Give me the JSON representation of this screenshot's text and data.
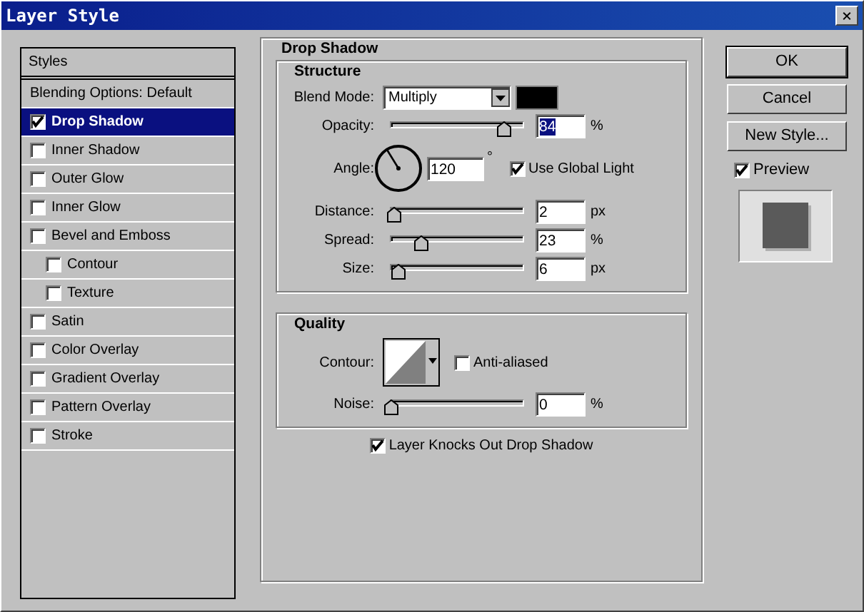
{
  "window": {
    "title": "Layer Style",
    "close": "×"
  },
  "styles_panel": {
    "header": "Styles",
    "blending": "Blending Options: Default",
    "items": [
      {
        "label": "Drop Shadow",
        "checked": true,
        "selected": true
      },
      {
        "label": "Inner Shadow",
        "checked": false,
        "selected": false
      },
      {
        "label": "Outer Glow",
        "checked": false,
        "selected": false
      },
      {
        "label": "Inner Glow",
        "checked": false,
        "selected": false
      },
      {
        "label": "Bevel and Emboss",
        "checked": false,
        "selected": false,
        "children": [
          {
            "label": "Contour",
            "checked": false,
            "selected": false
          },
          {
            "label": "Texture",
            "checked": false,
            "selected": false
          }
        ]
      },
      {
        "label": "Satin",
        "checked": false,
        "selected": false
      },
      {
        "label": "Color Overlay",
        "checked": false,
        "selected": false
      },
      {
        "label": "Gradient Overlay",
        "checked": false,
        "selected": false
      },
      {
        "label": "Pattern Overlay",
        "checked": false,
        "selected": false
      },
      {
        "label": "Stroke",
        "checked": false,
        "selected": false
      }
    ]
  },
  "drop_shadow": {
    "title": "Drop Shadow",
    "structure": {
      "title": "Structure",
      "blend_mode": {
        "label": "Blend Mode:",
        "value": "Multiply"
      },
      "opacity": {
        "label": "Opacity:",
        "level": 0.86,
        "value": "84",
        "unit": "%",
        "value_selected": true
      },
      "angle": {
        "label": "Angle:",
        "value": "120",
        "unit": "°",
        "global_light": {
          "label": "Use Global Light",
          "checked": true
        }
      },
      "sliders": [
        {
          "label": "Distance:",
          "level": 0.02,
          "value": "2",
          "unit": "px",
          "value_selected": false
        },
        {
          "label": "Spread:",
          "level": 0.23,
          "value": "23",
          "unit": "%",
          "value_selected": false
        },
        {
          "label": "Size:",
          "level": 0.05,
          "value": "6",
          "unit": "px",
          "value_selected": false
        }
      ]
    },
    "quality": {
      "title": "Quality",
      "contour_label": "Contour:",
      "anti_aliased": {
        "label": "Anti-aliased",
        "checked": false
      },
      "noise": {
        "label": "Noise:",
        "level": 0.0,
        "value": "0",
        "unit": "%",
        "value_selected": false
      }
    },
    "knockout": {
      "label": "Layer Knocks Out Drop Shadow",
      "checked": true
    }
  },
  "buttons": [
    {
      "label": "OK",
      "default": true
    },
    {
      "label": "Cancel",
      "default": false
    },
    {
      "label": "New Style...",
      "default": false
    }
  ],
  "preview": {
    "label": "Preview",
    "checked": true
  }
}
